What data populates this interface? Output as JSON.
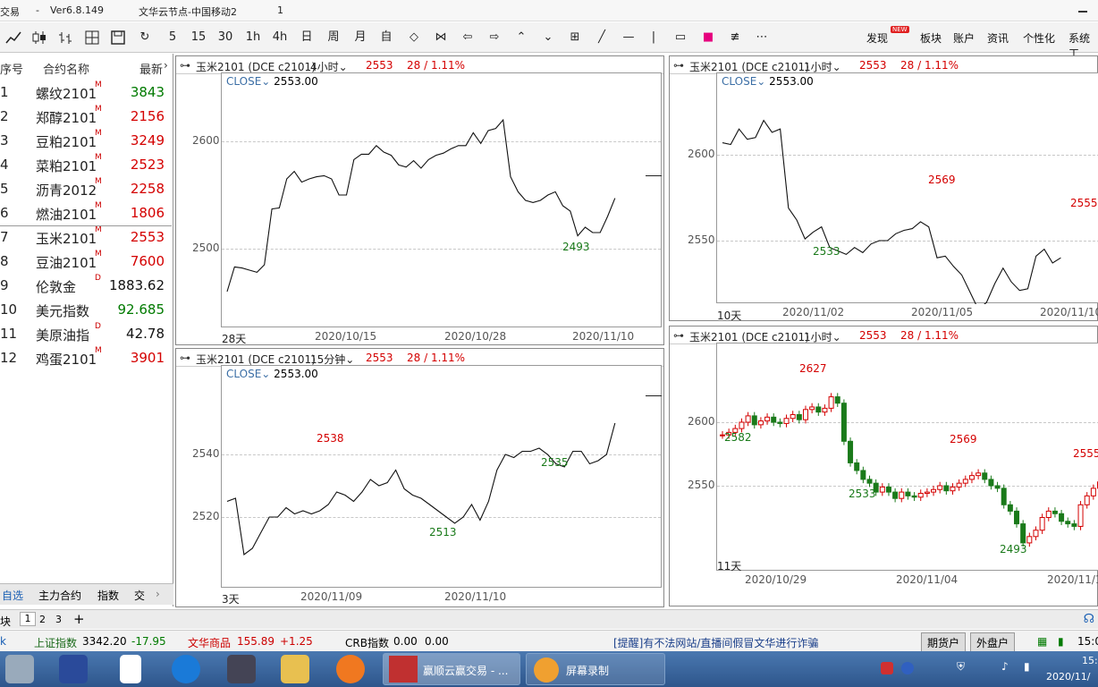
{
  "titlebar": {
    "app": "交易",
    "sep": "-",
    "version": "Ver6.8.149",
    "node": "文华云节点-中国移动2",
    "num": "1"
  },
  "toolbar": {
    "icons": [
      "line-chart-icon",
      "candle-icon",
      "bar-chart-icon",
      "mesh-icon",
      "save-icon",
      "refresh-icon"
    ],
    "periods": [
      "5",
      "15",
      "30",
      "1h",
      "4h",
      "日",
      "周",
      "月",
      "自"
    ],
    "right_menu": [
      "发现",
      "板块",
      "账户",
      "资讯",
      "个性化",
      "系统工"
    ],
    "new_badge": "NEW"
  },
  "left": {
    "headers": {
      "num": "序号",
      "name": "合约名称",
      "price": "最新"
    },
    "rows": [
      {
        "n": "1",
        "name": "螺纹2101",
        "sup": "M",
        "price": "3843",
        "color": "green"
      },
      {
        "n": "2",
        "name": "郑醇2101",
        "sup": "M",
        "price": "2156",
        "color": "red"
      },
      {
        "n": "3",
        "name": "豆粕2101",
        "sup": "M",
        "price": "3249",
        "color": "red"
      },
      {
        "n": "4",
        "name": "菜粕2101",
        "sup": "M",
        "price": "2523",
        "color": "red"
      },
      {
        "n": "5",
        "name": "沥青2012",
        "sup": "M",
        "price": "2258",
        "color": "red"
      },
      {
        "n": "6",
        "name": "燃油2101",
        "sup": "M",
        "price": "1806",
        "color": "red"
      },
      {
        "n": "7",
        "name": "玉米2101",
        "sup": "M",
        "price": "2553",
        "color": "red"
      },
      {
        "n": "8",
        "name": "豆油2101",
        "sup": "M",
        "price": "7600",
        "color": "red"
      },
      {
        "n": "9",
        "name": "伦敦金",
        "sup": "D",
        "price": "1883.62",
        "color": "blk"
      },
      {
        "n": "10",
        "name": "美元指数",
        "sup": "",
        "price": "92.685",
        "color": "green"
      },
      {
        "n": "11",
        "name": "美原油指",
        "sup": "D",
        "price": "42.78",
        "color": "blk"
      },
      {
        "n": "12",
        "name": "鸡蛋2101",
        "sup": "M",
        "price": "3901",
        "color": "red"
      }
    ],
    "tabs": [
      "自选",
      "主力合约",
      "指数",
      "交"
    ],
    "pages": [
      "块",
      "1",
      "2",
      "3",
      "+"
    ]
  },
  "panels": [
    {
      "title": "玉米2101 (DCE c2101)",
      "period": "4小时",
      "price": "2553",
      "change": "28 / 1.11%",
      "close_label": "CLOSE",
      "close_val": "2553.00",
      "range": "28天",
      "dates": [
        "2020/10/15",
        "2020/10/28",
        "2020/11/10"
      ]
    },
    {
      "title": "玉米2101 (DCE c2101)",
      "period": "1小时",
      "price": "2553",
      "change": "28 / 1.11%",
      "close_label": "CLOSE",
      "close_val": "2553.00",
      "range": "10天",
      "dates": [
        "2020/11/02",
        "2020/11/05",
        "2020/11/10"
      ]
    },
    {
      "title": "玉米2101 (DCE c2101)",
      "period": "15分钟",
      "price": "2553",
      "change": "28 / 1.11%",
      "close_label": "CLOSE",
      "close_val": "2553.00",
      "range": "3天",
      "dates": [
        "2020/11/09",
        "2020/11/10"
      ]
    },
    {
      "title": "玉米2101 (DCE c2101)",
      "period": "1小时",
      "price": "2553",
      "change": "28 / 1.11%",
      "range": "11天",
      "dates": [
        "2020/10/29",
        "2020/11/04",
        "2020/11/1"
      ]
    }
  ],
  "chart_data": [
    {
      "type": "line",
      "yticks": [
        "2600",
        "2500"
      ],
      "ylim": [
        2440,
        2650
      ],
      "values": [
        2460,
        2483,
        2482,
        2480,
        2478,
        2485,
        2537,
        2538,
        2565,
        2572,
        2562,
        2565,
        2567,
        2568,
        2565,
        2550,
        2550,
        2583,
        2588,
        2588,
        2596,
        2590,
        2587,
        2578,
        2576,
        2582,
        2575,
        2583,
        2587,
        2589,
        2593,
        2596,
        2596,
        2608,
        2598,
        2610,
        2612,
        2620,
        2567,
        2553,
        2545,
        2543,
        2545,
        2550,
        2553,
        2540,
        2535,
        2512,
        2520,
        2515,
        2515,
        2530,
        2547
      ],
      "labels": [
        {
          "text": "2493",
          "color": "green"
        }
      ]
    },
    {
      "type": "line",
      "yticks": [
        "2600",
        "2550"
      ],
      "ylim": [
        2505,
        2630
      ],
      "values": [
        2607,
        2606,
        2615,
        2609,
        2610,
        2620,
        2613,
        2615,
        2569,
        2562,
        2551,
        2555,
        2558,
        2546,
        2544,
        2542,
        2546,
        2543,
        2548,
        2550,
        2550,
        2554,
        2556,
        2557,
        2561,
        2558,
        2540,
        2541,
        2535,
        2530,
        2520,
        2510,
        2514,
        2525,
        2534,
        2526,
        2521,
        2522,
        2541,
        2545,
        2537,
        2540
      ],
      "labels": [
        {
          "text": "2569",
          "color": "red"
        },
        {
          "text": "2533",
          "color": "green"
        },
        {
          "text": "2555",
          "color": "red"
        }
      ]
    },
    {
      "type": "line",
      "yticks": [
        "2540",
        "2520"
      ],
      "ylim": [
        2505,
        2550
      ],
      "values": [
        2525,
        2526,
        2508,
        2510,
        2515,
        2520,
        2520,
        2523,
        2521,
        2522,
        2521,
        2522,
        2524,
        2528,
        2527,
        2525,
        2528,
        2532,
        2530,
        2531,
        2535,
        2529,
        2527,
        2526,
        2524,
        2522,
        2520,
        2518,
        2520,
        2524,
        2519,
        2525,
        2535,
        2540,
        2539,
        2541,
        2541,
        2542,
        2540,
        2537,
        2536,
        2541,
        2541,
        2537,
        2538,
        2540,
        2550
      ],
      "labels": [
        {
          "text": "2538",
          "color": "red"
        },
        {
          "text": "2513",
          "color": "green"
        },
        {
          "text": "2535",
          "color": "green"
        }
      ]
    },
    {
      "type": "candlestick",
      "yticks": [
        "2600",
        "2550"
      ],
      "ylim": [
        2480,
        2650
      ],
      "values": [
        2590,
        2592,
        2595,
        2600,
        2605,
        2598,
        2601,
        2604,
        2600,
        2599,
        2603,
        2606,
        2602,
        2610,
        2612,
        2608,
        2611,
        2620,
        2615,
        2585,
        2568,
        2562,
        2555,
        2552,
        2545,
        2549,
        2545,
        2540,
        2545,
        2542,
        2541,
        2544,
        2545,
        2547,
        2550,
        2546,
        2549,
        2552,
        2555,
        2558,
        2560,
        2555,
        2550,
        2548,
        2535,
        2530,
        2520,
        2505,
        2510,
        2515,
        2525,
        2530,
        2528,
        2522,
        2520,
        2518,
        2535,
        2542,
        2548,
        2553
      ],
      "labels": [
        {
          "text": "2627",
          "color": "red"
        },
        {
          "text": "2582",
          "color": "green"
        },
        {
          "text": "2569",
          "color": "red"
        },
        {
          "text": "2533",
          "color": "green"
        },
        {
          "text": "2493",
          "color": "green"
        },
        {
          "text": "2555",
          "color": "red"
        }
      ]
    }
  ],
  "status": {
    "sh_label": "上证指数",
    "sh_val": "3342.20",
    "sh_chg": "-17.95",
    "wh_label": "文华商品",
    "wh_val": "155.89",
    "wh_chg": "+1.25",
    "crb_label": "CRB指数",
    "crb_val": "0.00",
    "crb_chg": "0.00",
    "notice": "[提醒]有不法网站/直播间假冒文华进行诈骗",
    "btn1": "期货户",
    "btn2": "外盘户",
    "time": "15:0"
  },
  "taskbar": {
    "app1": "赢顺云赢交易 - ...",
    "app2": "屏幕录制",
    "clock": "15:",
    "date": "2020/11/"
  }
}
